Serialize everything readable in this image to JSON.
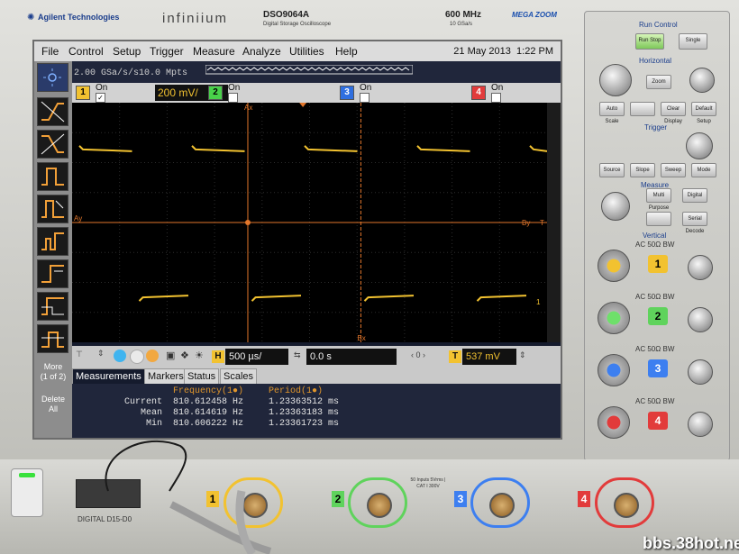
{
  "brand": {
    "company": "Agilent Technologies",
    "series": "infiniium",
    "model": "DSO9064A",
    "model_sub": "Digital Storage Oscilloscope",
    "bandwidth": "600 MHz",
    "sample_rate": "10 GSa/s",
    "megazoom": "MEGA ZOOM"
  },
  "menu": {
    "items": [
      "File",
      "Control",
      "Setup",
      "Trigger",
      "Measure",
      "Analyze",
      "Utilities",
      "Help"
    ],
    "date": "21 May 2013",
    "time": "1:22 PM"
  },
  "acquisition": {
    "rate": "2.00 GSa/s",
    "memory": "10.0 Mpts"
  },
  "channels": [
    {
      "num": "1",
      "state": "On",
      "checked": true,
      "scale": "200 mV/",
      "color": "#f2c230"
    },
    {
      "num": "2",
      "state": "On",
      "checked": false,
      "color": "#49d24a"
    },
    {
      "num": "3",
      "state": "On",
      "checked": false,
      "color": "#2f6fe0"
    },
    {
      "num": "4",
      "state": "On",
      "checked": false,
      "color": "#e23b3b"
    }
  ],
  "markers": {
    "ax": "Ax",
    "ay": "Ay",
    "bx": "Bx",
    "by": "By",
    "t": "T"
  },
  "waveform": {
    "label": "1",
    "high_level": 0.78,
    "low_level": -0.78,
    "color": "#f2c230"
  },
  "timebase": {
    "h_label": "H",
    "scale": "500 µs/",
    "delay": "0.0 s",
    "t_label": "T",
    "trigger_level": "537 mV"
  },
  "left_panel": {
    "more": "More",
    "more_pages": "(1 of 2)",
    "delete": "Delete",
    "all": "All"
  },
  "tabs": [
    "Measurements",
    "Markers",
    "Status",
    "Scales"
  ],
  "measurements": {
    "headers": [
      "Frequency(1●)",
      "Period(1●)"
    ],
    "rows": [
      {
        "label": "Current",
        "freq": "810.612458 Hz",
        "period": "1.23363512 ms"
      },
      {
        "label": "Mean",
        "freq": "810.614619 Hz",
        "period": "1.23363183 ms"
      },
      {
        "label": "Min",
        "freq": "810.606222 Hz",
        "period": "1.23361723 ms"
      }
    ]
  },
  "panel": {
    "run_control": "Run Control",
    "run_stop": "Run Stop",
    "single": "Single",
    "horizontal": "Horizontal",
    "zoom": "Zoom",
    "auto_scale": "Auto Scale",
    "clear_display": "Clear Display",
    "default_setup": "Default Setup",
    "trigger": "Trigger",
    "source": "Source",
    "slope": "Slope",
    "sweep": "Sweep",
    "mode": "Mode",
    "measure": "Measure",
    "multi_purpose": "Multi Purpose",
    "digital": "Digital",
    "serial_decode": "Serial Decode",
    "vertical": "Vertical",
    "ac": "AC",
    "ohm": "50Ω",
    "bw": "BW"
  },
  "front": {
    "digital_label": "DIGITAL D15-D0",
    "inputs": [
      "1",
      "2",
      "3",
      "4"
    ],
    "warning": "50 Inputs 5Vrms | CAT I 300V"
  },
  "watermark": "bbs.38hot.net"
}
